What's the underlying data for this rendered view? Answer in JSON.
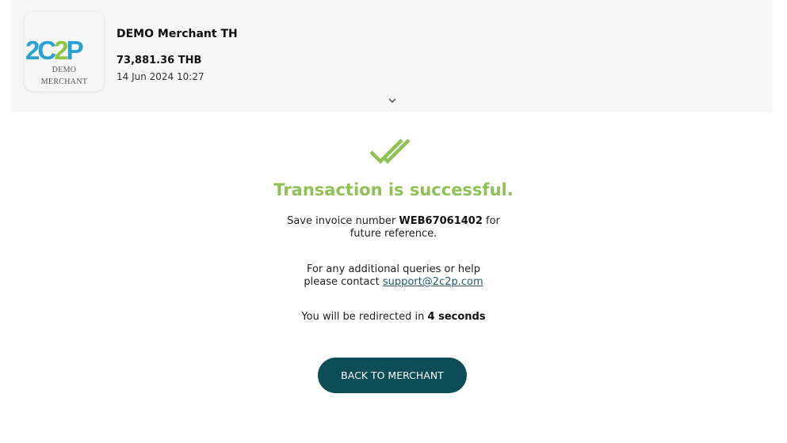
{
  "merchant": {
    "logo_text": "2C2P",
    "logo_sub_line1": "DEMO",
    "logo_sub_line2": "MERCHANT",
    "name": "DEMO Merchant TH",
    "amount": "73,881.36 THB",
    "datetime": "14 Jun 2024 10:27"
  },
  "result": {
    "title": "Transaction is successful.",
    "invoice_prefix": "Save invoice number",
    "invoice_number": "WEB67061402",
    "invoice_suffix": "for",
    "invoice_line2": "future reference.",
    "help_line1": "For any additional queries or help",
    "help_line2_prefix": "please contact",
    "support_email": "support@2c2p.com",
    "redirect_prefix": "You will be redirected in",
    "redirect_time": "4 seconds"
  },
  "actions": {
    "back_label": "BACK TO MERCHANT"
  },
  "colors": {
    "success": "#8fc155",
    "button": "#0c4d57",
    "logo_blue": "#2aa0d3",
    "logo_green": "#8dc63f"
  },
  "icons": {
    "header_toggle": "chevron-down-icon",
    "status": "double-check-icon"
  }
}
